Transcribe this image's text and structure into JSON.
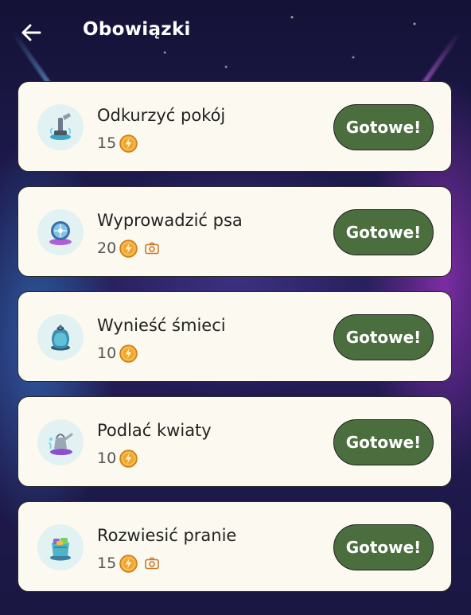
{
  "header": {
    "title": "Obowiązki",
    "back_icon": "arrow-left-icon"
  },
  "tasks": [
    {
      "name": "Odkurzyć pokój",
      "points": "15",
      "photo_required": false,
      "icon": "vacuum-icon",
      "button": "Gotowe!"
    },
    {
      "name": "Wyprowadzić psa",
      "points": "20",
      "photo_required": true,
      "icon": "dog-walk-icon",
      "button": "Gotowe!"
    },
    {
      "name": "Wynieść śmieci",
      "points": "10",
      "photo_required": false,
      "icon": "trash-bag-icon",
      "button": "Gotowe!"
    },
    {
      "name": "Podlać kwiaty",
      "points": "10",
      "photo_required": false,
      "icon": "watering-can-icon",
      "button": "Gotowe!"
    },
    {
      "name": "Rozwiesić pranie",
      "points": "15",
      "photo_required": true,
      "icon": "laundry-icon",
      "button": "Gotowe!"
    }
  ],
  "colors": {
    "card_bg": "#fcfaf0",
    "button_bg": "#4b6e3f",
    "coin": "#f0a530",
    "camera": "#c8772a"
  }
}
